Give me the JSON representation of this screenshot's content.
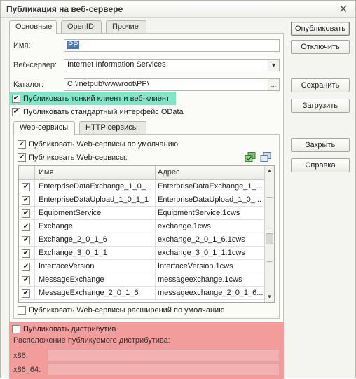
{
  "window": {
    "title": "Публикация на веб-сервере"
  },
  "tabs": [
    "Основные",
    "OpenID",
    "Прочие"
  ],
  "form": {
    "name_label": "Имя:",
    "name_value": "PP",
    "webserver_label": "Веб-сервер:",
    "webserver_value": "Internet Information Services",
    "catalog_label": "Каталог:",
    "catalog_value": "C:\\inetpub\\wwwroot\\PP\\",
    "catalog_button": "..."
  },
  "options": {
    "publish_thin_client": {
      "label": "Публиковать тонкий клиент и веб-клиент",
      "checked": true
    },
    "publish_odata": {
      "label": "Публиковать стандартный интерфейс OData",
      "checked": true
    }
  },
  "inner_tabs": [
    "Web-сервисы",
    "HTTP сервисы"
  ],
  "webservices": {
    "publish_default": {
      "label": "Публиковать Web-сервисы по умолчанию",
      "checked": true
    },
    "publish_ws": {
      "label": "Публиковать Web-сервисы:",
      "checked": true
    },
    "columns": [
      "Имя",
      "Адрес"
    ],
    "rows": [
      {
        "checked": true,
        "name": "EnterpriseDataExchange_1_0_...",
        "address": "EnterpriseDataExchange_1_..."
      },
      {
        "checked": true,
        "name": "EnterpriseDataUpload_1_0_1_1",
        "address": "EnterpriseDataUpload_1_0_..."
      },
      {
        "checked": true,
        "name": "EquipmentService",
        "address": "EquipmentService.1cws"
      },
      {
        "checked": true,
        "name": "Exchange",
        "address": "exchange.1cws"
      },
      {
        "checked": true,
        "name": "Exchange_2_0_1_6",
        "address": "exchange_2_0_1_6.1cws"
      },
      {
        "checked": true,
        "name": "Exchange_3_0_1_1",
        "address": "exchange_3_0_1_1.1cws"
      },
      {
        "checked": true,
        "name": "InterfaceVersion",
        "address": "InterfaceVersion.1cws"
      },
      {
        "checked": true,
        "name": "MessageExchange",
        "address": "messageexchange.1cws"
      },
      {
        "checked": true,
        "name": "MessageExchange_2_0_1_6",
        "address": "messageexchange_2_0_1_6..."
      }
    ],
    "publish_extensions": {
      "label": "Публиковать Web-сервисы расширений по умолчанию",
      "checked": false
    }
  },
  "distributive": {
    "publish": {
      "label": "Публиковать дистрибутив",
      "checked": false
    },
    "location_label": "Расположение публикуемого дистрибутива:",
    "x86_label": "x86:",
    "x86_64_label": "x86_64:"
  },
  "buttons": {
    "publish": "Опубликовать",
    "disable": "Отключить",
    "save": "Сохранить",
    "load": "Загрузить",
    "close": "Закрыть",
    "help": "Справка"
  },
  "colors": {
    "highlight_green": "#7ee7c8",
    "highlight_red": "#f29c9c",
    "selection_blue": "#4a77c2"
  }
}
